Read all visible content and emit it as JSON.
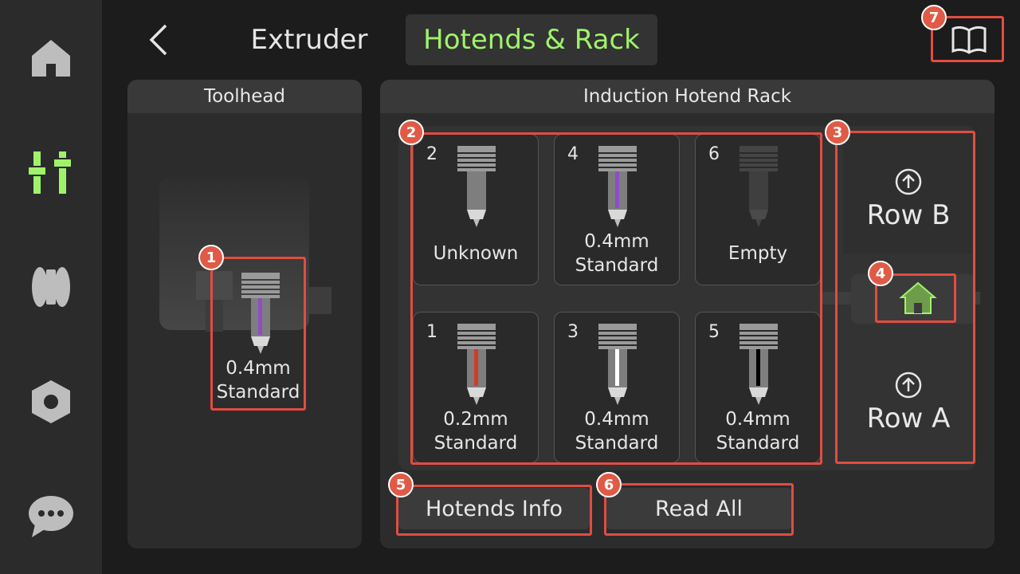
{
  "header": {
    "tab_extruder": "Extruder",
    "tab_hotends_rack": "Hotends & Rack"
  },
  "toolhead": {
    "title": "Toolhead",
    "hotend_label": "0.4mm\nStandard",
    "filament_color": "#8c4fc4"
  },
  "rack": {
    "title": "Induction Hotend Rack",
    "slots": [
      {
        "number": "2",
        "label": "Unknown",
        "filament_color": null,
        "empty": false
      },
      {
        "number": "4",
        "label": "0.4mm\nStandard",
        "filament_color": "#8c4fc4",
        "empty": false
      },
      {
        "number": "6",
        "label": "Empty",
        "filament_color": null,
        "empty": true
      },
      {
        "number": "1",
        "label": "0.2mm\nStandard",
        "filament_color": "#d23a2a",
        "empty": false
      },
      {
        "number": "3",
        "label": "0.4mm\nStandard",
        "filament_color": "#ffffff",
        "empty": false
      },
      {
        "number": "5",
        "label": "0.4mm\nStandard",
        "filament_color": "#000000",
        "empty": false
      }
    ],
    "row_b": "Row B",
    "row_a": "Row A"
  },
  "buttons": {
    "hotends_info": "Hotends Info",
    "read_all": "Read All"
  },
  "badges": [
    "1",
    "2",
    "3",
    "4",
    "5",
    "6",
    "7"
  ],
  "colors": {
    "accent_green": "#9ff36b",
    "annotation_red": "#e24c41"
  },
  "icons": {
    "sidebar": [
      "home-icon",
      "tune-icon",
      "filament-icon",
      "settings-hex-icon",
      "chat-icon"
    ],
    "manual": "book-icon",
    "back": "chevron-left-icon"
  }
}
